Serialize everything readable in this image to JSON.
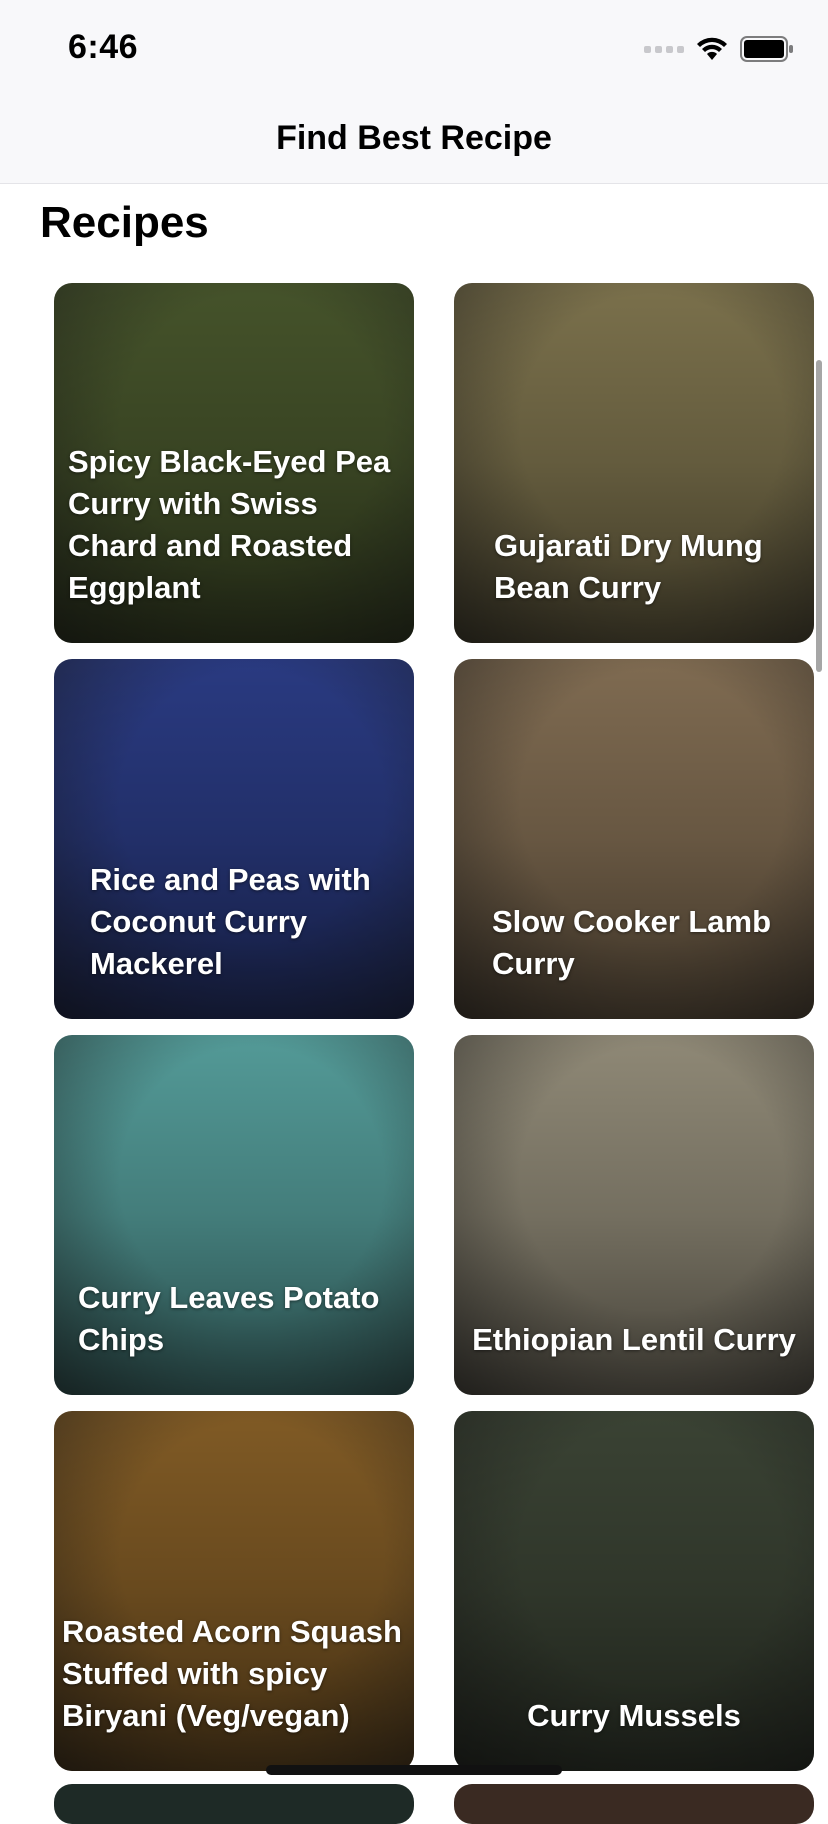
{
  "status_bar": {
    "time": "6:46",
    "signal_icon": "signal-dots-icon",
    "wifi_icon": "wifi-icon",
    "battery_icon": "battery-icon"
  },
  "nav": {
    "title": "Find Best Recipe"
  },
  "section": {
    "title": "Recipes"
  },
  "recipes": [
    {
      "title": "Spicy Black-Eyed Pea Curry with Swiss Chard and Roasted Eggplant",
      "color": "#4b5a2e"
    },
    {
      "title": "Gujarati Dry Mung Bean Curry",
      "color": "#857a52"
    },
    {
      "title": "Rice and Peas with Coconut Curry Mackerel",
      "color": "#2d3f8c"
    },
    {
      "title": "Slow Cooker Lamb Curry",
      "color": "#8a7458"
    },
    {
      "title": "Curry Leaves Potato Chips",
      "color": "#5aa7a4"
    },
    {
      "title": "Ethiopian Lentil Curry",
      "color": "#9b9480"
    },
    {
      "title": "Roasted Acorn Squash Stuffed with spicy Biryani (Veg/vegan)",
      "color": "#8b6228"
    },
    {
      "title": "Curry Mussels",
      "color": "#3f4838"
    }
  ]
}
